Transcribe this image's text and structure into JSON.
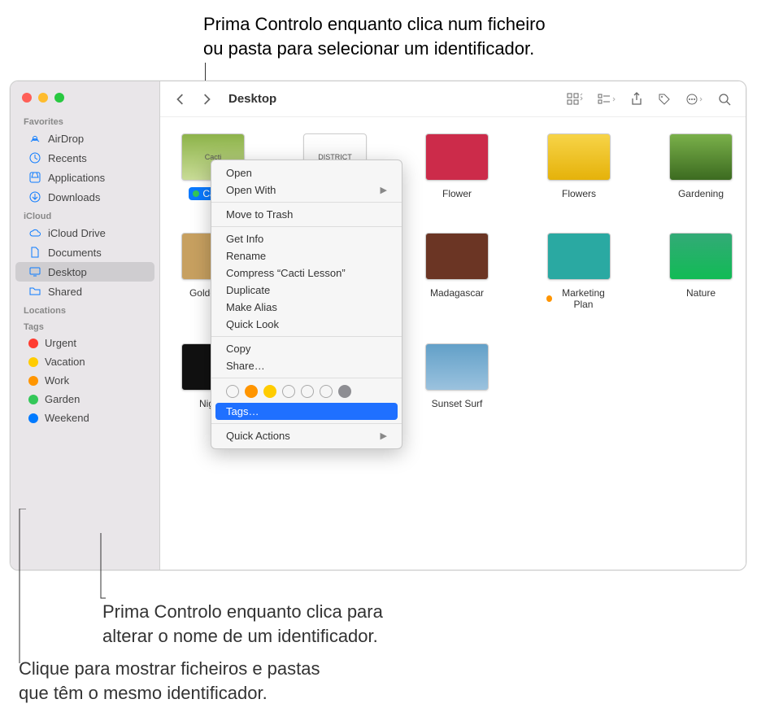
{
  "callouts": {
    "top_l1": "Prima Controlo enquanto clica num ficheiro",
    "top_l2": "ou pasta para selecionar um identificador.",
    "b1_l1": "Prima Controlo enquanto clica para",
    "b1_l2": "alterar o nome de um identificador.",
    "b2_l1": "Clique para mostrar ficheiros e pastas",
    "b2_l2": "que têm o mesmo identificador."
  },
  "toolbar": {
    "title": "Desktop"
  },
  "sidebar": {
    "favorites_header": "Favorites",
    "airdrop": "AirDrop",
    "recents": "Recents",
    "applications": "Applications",
    "downloads": "Downloads",
    "icloud_header": "iCloud",
    "iclouddrive": "iCloud Drive",
    "documents": "Documents",
    "desktop": "Desktop",
    "shared": "Shared",
    "locations_header": "Locations",
    "tags_header": "Tags",
    "tags": {
      "urgent": {
        "label": "Urgent",
        "color": "#ff3b30"
      },
      "vacation": {
        "label": "Vacation",
        "color": "#ffcc00"
      },
      "work": {
        "label": "Work",
        "color": "#ff9500"
      },
      "garden": {
        "label": "Garden",
        "color": "#34c759"
      },
      "weekend": {
        "label": "Weekend",
        "color": "#007aff"
      }
    }
  },
  "files": {
    "cacti": {
      "label": "Cacti L",
      "tagcolor": "#34c759"
    },
    "district": {
      "label": "District"
    },
    "flower": {
      "label": "Flower"
    },
    "flowers": {
      "label": "Flowers"
    },
    "gardening": {
      "label": "Gardening"
    },
    "golden": {
      "label": "Golden Ga"
    },
    "madagascar": {
      "label": "Madagascar"
    },
    "marketing": {
      "label": "Marketing Plan",
      "tagcolor": "#ff9500"
    },
    "nature": {
      "label": "Nature"
    },
    "nighttime": {
      "label": "Nightti"
    },
    "sunset": {
      "label": "Sunset Surf"
    }
  },
  "contextmenu": {
    "open": "Open",
    "openwith": "Open With",
    "movetrash": "Move to Trash",
    "getinfo": "Get Info",
    "rename": "Rename",
    "compress": "Compress “Cacti Lesson”",
    "duplicate": "Duplicate",
    "makealias": "Make Alias",
    "quicklook": "Quick Look",
    "copy": "Copy",
    "share": "Share…",
    "tags": "Tags…",
    "quickactions": "Quick Actions",
    "tagcolors": [
      "#ffffff00",
      "#ff9500",
      "#ffcc00",
      "#ffffff00",
      "#ffffff00",
      "#ffffff00",
      "#8e8e93"
    ]
  }
}
